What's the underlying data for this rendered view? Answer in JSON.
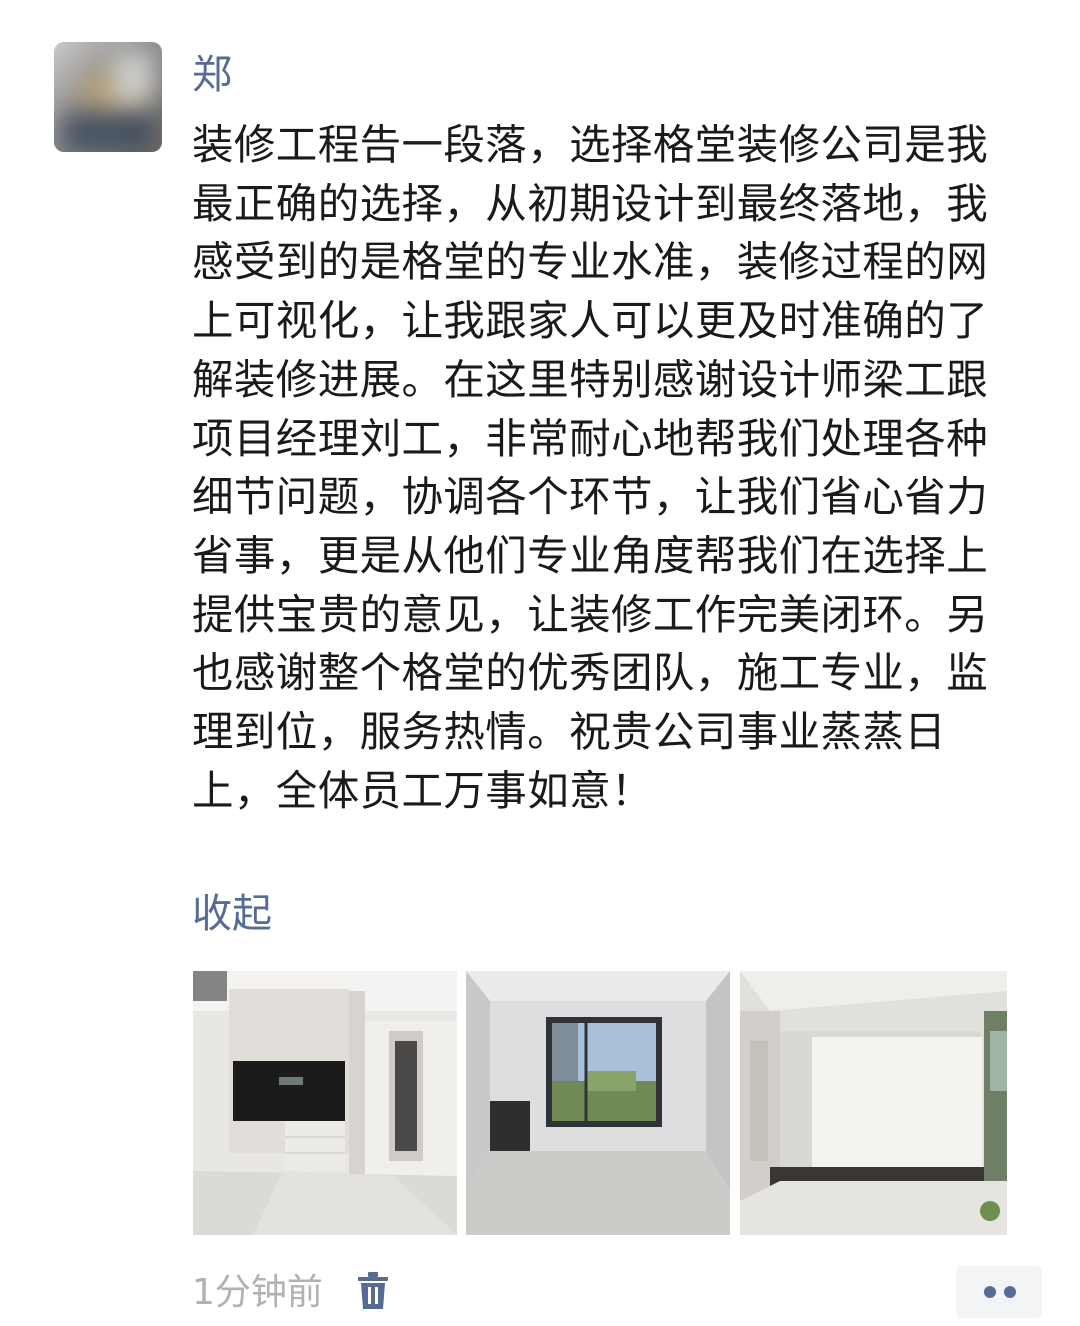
{
  "post": {
    "author_name": "郑",
    "text": "装修工程告一段落，选择格堂装修公司是我最正确的选择，从初期设计到最终落地，我感受到的是格堂的专业水准，装修过程的网上可视化，让我跟家人可以更及时准确的了解装修进展。在这里特别感谢设计师梁工跟项目经理刘工，非常耐心地帮我们处理各种细节问题，协调各个环节，让我们省心省力省事，更是从他们专业角度帮我们在选择上提供宝贵的意见，让装修工作完美闭环。另也感谢整个格堂的优秀团队，施工专业，监理到位，服务热情。祝贵公司事业蒸蒸日上，全体员工万事如意！",
    "collapse_label": "收起",
    "timestamp": "1分钟前",
    "icons": {
      "delete": "trash-icon",
      "more": "more-dots-icon"
    },
    "colors": {
      "link": "#576b95",
      "text": "#1a1a1a",
      "meta": "#b2b2b2",
      "more_bg": "#f3f4f6"
    }
  }
}
